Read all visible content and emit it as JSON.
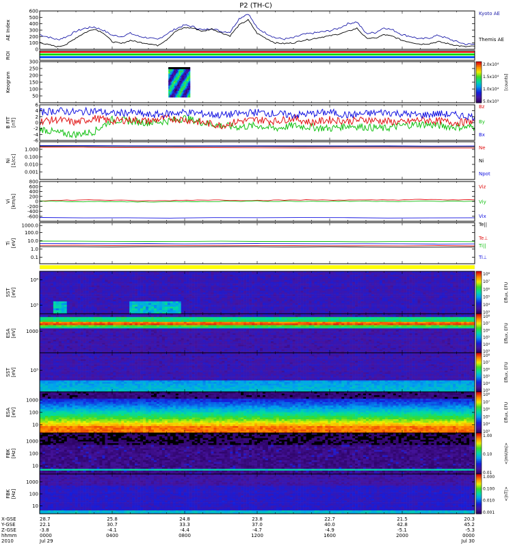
{
  "title": "P2 (TH-C)",
  "colors": {
    "kyoto": "#1a1aa8",
    "themis": "#000000",
    "red": "#e01010",
    "green": "#10c010",
    "blue": "#1010e0",
    "black": "#000000",
    "yellow": "#ffff00"
  },
  "chart_data": [
    {
      "type": "line",
      "panel": "ae",
      "ylabel": "AE Index",
      "ylim": [
        0,
        600
      ],
      "yticks": [
        "0",
        "100",
        "200",
        "300",
        "400",
        "500",
        "600"
      ],
      "legend": [
        "Kyoto AE",
        "Themis AE"
      ],
      "series": [
        {
          "name": "Kyoto AE",
          "x": [
            0,
            0.5,
            1,
            1.5,
            2,
            2.5,
            3,
            3.5,
            4,
            4.5,
            5,
            5.5,
            6,
            6.5,
            7,
            7.5,
            8,
            8.5,
            9,
            9.5,
            10,
            10.5,
            11,
            11.5,
            12,
            12.5,
            13,
            13.5,
            14,
            14.5,
            15,
            15.5,
            16,
            16.5,
            17,
            17.5,
            18,
            18.5,
            19,
            19.5,
            20,
            20.5,
            21,
            21.5,
            22,
            22.5,
            23,
            23.5,
            24
          ],
          "values": [
            230,
            190,
            150,
            200,
            280,
            330,
            350,
            300,
            220,
            200,
            250,
            200,
            180,
            150,
            240,
            320,
            380,
            350,
            300,
            330,
            280,
            270,
            480,
            560,
            330,
            250,
            180,
            160,
            180,
            230,
            250,
            270,
            290,
            330,
            400,
            430,
            250,
            260,
            340,
            300,
            230,
            200,
            160,
            180,
            220,
            170,
            120,
            80,
            80
          ]
        },
        {
          "name": "Themis AE",
          "x": [
            0,
            0.5,
            1,
            1.5,
            2,
            2.5,
            3,
            3.5,
            4,
            4.5,
            5,
            5.5,
            6,
            6.5,
            7,
            7.5,
            8,
            8.5,
            9,
            9.5,
            10,
            10.5,
            11,
            11.5,
            12,
            12.5,
            13,
            13.5,
            14,
            14.5,
            15,
            15.5,
            16,
            16.5,
            17,
            17.5,
            18,
            18.5,
            19,
            19.5,
            20,
            20.5,
            21,
            21.5,
            22,
            22.5,
            23,
            23.5,
            24
          ],
          "values": [
            110,
            70,
            40,
            80,
            180,
            260,
            320,
            260,
            120,
            90,
            140,
            110,
            90,
            60,
            150,
            280,
            340,
            330,
            280,
            320,
            260,
            210,
            380,
            460,
            250,
            170,
            100,
            90,
            100,
            140,
            160,
            190,
            210,
            240,
            280,
            330,
            180,
            170,
            230,
            200,
            140,
            110,
            80,
            90,
            120,
            90,
            60,
            40,
            50
          ]
        }
      ]
    },
    {
      "type": "heatmap",
      "panel": "roi",
      "ylabel": "ROI"
    },
    {
      "type": "heatmap",
      "panel": "keogram",
      "ylabel": "Keogram",
      "ylim": [
        0,
        300
      ],
      "yticks": [
        "50",
        "100",
        "150",
        "200",
        "250",
        "300"
      ],
      "colorbar": {
        "label": "[counts]",
        "ticks": [
          "2.0x10⁴",
          "1.5x10⁴",
          "1.0x10⁴",
          "5.0x10³"
        ]
      },
      "data_interval_hours": [
        7.1,
        8.3
      ]
    },
    {
      "type": "line",
      "panel": "bfield",
      "ylabel": "B FIT",
      "yunit": "[nT]",
      "ylim": [
        -6,
        6
      ],
      "yticks": [
        "-6",
        "-4",
        "-2",
        "0",
        "2",
        "4",
        "6"
      ],
      "legend": [
        "Bz",
        "By",
        "Bx"
      ],
      "series": [
        {
          "name": "Bz",
          "x": [
            0,
            1,
            2,
            3,
            4,
            5,
            6,
            7,
            8,
            9,
            10,
            11,
            12,
            13,
            14,
            15,
            16,
            17,
            18,
            19,
            20,
            21,
            22,
            23,
            24
          ],
          "values": [
            0.5,
            1.0,
            0.0,
            1.5,
            0.5,
            1.0,
            0.5,
            1.5,
            1.0,
            0.0,
            -1.0,
            0.5,
            1.0,
            0.5,
            1.5,
            0.0,
            1.0,
            0.5,
            1.0,
            0.5,
            0.0,
            1.0,
            0.5,
            0.0,
            0.5
          ]
        },
        {
          "name": "By",
          "x": [
            0,
            1,
            2,
            3,
            4,
            5,
            6,
            7,
            8,
            9,
            10,
            11,
            12,
            13,
            14,
            15,
            16,
            17,
            18,
            19,
            20,
            21,
            22,
            23,
            24
          ],
          "values": [
            -2.0,
            -3.5,
            -4.0,
            -3.0,
            1.0,
            0.5,
            0.0,
            0.5,
            1.5,
            0.0,
            -1.0,
            -1.5,
            -1.0,
            -2.0,
            -1.0,
            -1.5,
            -2.0,
            -1.0,
            -1.5,
            -2.0,
            -1.0,
            -0.5,
            -1.0,
            -1.5,
            -1.5
          ]
        },
        {
          "name": "Bx",
          "x": [
            0,
            1,
            2,
            3,
            4,
            5,
            6,
            7,
            8,
            9,
            10,
            11,
            12,
            13,
            14,
            15,
            16,
            17,
            18,
            19,
            20,
            21,
            22,
            23,
            24
          ],
          "values": [
            3.5,
            4.0,
            3.5,
            4.0,
            3.0,
            3.5,
            2.5,
            3.0,
            3.5,
            3.0,
            2.5,
            3.0,
            3.5,
            3.0,
            2.5,
            3.0,
            3.5,
            2.5,
            3.0,
            3.5,
            3.0,
            2.5,
            3.0,
            2.5,
            2.0
          ]
        }
      ]
    },
    {
      "type": "line",
      "panel": "density",
      "ylabel": "Ni",
      "yunit": "[1/cc]",
      "scale": "log",
      "ylim": [
        0.0001,
        10
      ],
      "yticks": [
        "0.001",
        "0.010",
        "0.100",
        "1.000"
      ],
      "legend": [
        "Ne",
        "Ni",
        "Npot"
      ],
      "series": [
        {
          "name": "Ne",
          "x": [
            0,
            24
          ],
          "values": [
            1.8,
            1.5
          ]
        },
        {
          "name": "Ni",
          "x": [
            0,
            24
          ],
          "values": [
            2.5,
            2.2
          ]
        },
        {
          "name": "Npot",
          "x": [
            0,
            24
          ],
          "values": [
            3.0,
            2.8
          ]
        }
      ]
    },
    {
      "type": "line",
      "panel": "velocity",
      "ylabel": "Vi",
      "yunit": "[km/s]",
      "ylim": [
        -800,
        800
      ],
      "yticks": [
        "-600",
        "-400",
        "-200",
        "0",
        "200",
        "400",
        "600",
        "800"
      ],
      "legend": [
        "Viz",
        "Viy",
        "Vix"
      ],
      "series": [
        {
          "name": "Viz",
          "x": [
            0,
            3,
            6,
            9,
            12,
            15,
            18,
            21,
            24
          ],
          "values": [
            30,
            60,
            20,
            60,
            40,
            60,
            50,
            70,
            60
          ]
        },
        {
          "name": "Viy",
          "x": [
            0,
            3,
            6,
            9,
            12,
            15,
            18,
            21,
            24
          ],
          "values": [
            10,
            -10,
            -20,
            0,
            10,
            0,
            10,
            0,
            10
          ]
        },
        {
          "name": "Vix",
          "x": [
            0,
            24
          ],
          "values": [
            -660,
            -660
          ]
        }
      ]
    },
    {
      "type": "line",
      "panel": "temperature",
      "ylabel": "Ti",
      "yunit": "[eV]",
      "scale": "log",
      "ylim": [
        0.05,
        10000
      ],
      "yticks": [
        "0.1",
        "1.0",
        "10.0",
        "100.0",
        "1000.0"
      ],
      "legend": [
        "Te||",
        "Te⊥",
        "Ti||",
        "Ti⊥"
      ],
      "series": [
        {
          "name": "Te||",
          "x": [
            0,
            24
          ],
          "values": [
            40,
            35
          ]
        },
        {
          "name": "Te⊥",
          "x": [
            0,
            24
          ],
          "values": [
            12,
            10
          ]
        },
        {
          "name": "Ti||",
          "x": [
            0,
            24
          ],
          "values": [
            20,
            18
          ]
        },
        {
          "name": "Ti⊥",
          "x": [
            0,
            24
          ],
          "values": [
            8,
            7
          ]
        }
      ]
    },
    {
      "type": "heatmap",
      "panel": "sst_ion",
      "ylabel": "SST",
      "yunit": "[eV]",
      "yticks": [
        "10⁵",
        "10⁶"
      ],
      "colorbar": {
        "label": "Eflux, EFU",
        "ticks": [
          "10⁸",
          "10⁷",
          "10⁶",
          "10⁵",
          "10⁴",
          "10³"
        ]
      }
    },
    {
      "type": "heatmap",
      "panel": "esa_ion",
      "ylabel": "ESA",
      "yunit": "[eV]",
      "yticks": [
        "1000"
      ],
      "colorbar": {
        "label": "Eflux, EFU",
        "ticks": [
          "10⁸",
          "10⁷",
          "10⁶",
          "10⁵",
          "10⁴",
          "10³"
        ]
      }
    },
    {
      "type": "heatmap",
      "panel": "sst_elec",
      "ylabel": "SST",
      "yunit": "[eV]",
      "yticks": [
        "10⁵"
      ],
      "colorbar": {
        "label": "Eflux, EFU",
        "ticks": [
          "10⁸",
          "10⁷",
          "10⁶",
          "10⁵",
          "10⁴",
          "10³"
        ]
      }
    },
    {
      "type": "heatmap",
      "panel": "esa_elec",
      "ylabel": "ESA",
      "yunit": "[eV]",
      "yticks": [
        "10",
        "100",
        "1000"
      ],
      "colorbar": {
        "label": "Eflux, EFU",
        "ticks": [
          "10⁸",
          "10⁷",
          "10⁶",
          "10⁵",
          "10⁴",
          "10³"
        ]
      }
    },
    {
      "type": "heatmap",
      "panel": "fbk_edc",
      "ylabel": "FBK",
      "yunit": "[Hz]",
      "yticks": [
        "10",
        "100",
        "1000"
      ],
      "colorbar": {
        "label": "<|mV/m|>",
        "ticks": [
          "1.00",
          "0.10",
          "0.01"
        ]
      }
    },
    {
      "type": "heatmap",
      "panel": "fbk_scm",
      "ylabel": "FBK",
      "yunit": "[Hz]",
      "yticks": [
        "10",
        "100",
        "1000"
      ],
      "colorbar": {
        "label": "<|nT|>",
        "ticks": [
          "1.000",
          "0.100",
          "0.010",
          "0.001"
        ]
      }
    }
  ],
  "time_axis": {
    "row_labels": [
      "X-GSE",
      "Y-GSE",
      "Z-GSE",
      "hhmm",
      "2010"
    ],
    "columns": [
      {
        "x_hours": 0,
        "rows": [
          "28.7",
          "22.1",
          "-3.8",
          "0000",
          "Jul 29"
        ]
      },
      {
        "x_hours": 4,
        "rows": [
          "25.8",
          "30.7",
          "-4.1",
          "0400",
          ""
        ]
      },
      {
        "x_hours": 8,
        "rows": [
          "24.8",
          "33.3",
          "-4.4",
          "0800",
          ""
        ]
      },
      {
        "x_hours": 12,
        "rows": [
          "23.8",
          "37.0",
          "-4.7",
          "1200",
          ""
        ]
      },
      {
        "x_hours": 16,
        "rows": [
          "22.7",
          "40.0",
          "-4.9",
          "1600",
          ""
        ]
      },
      {
        "x_hours": 20,
        "rows": [
          "21.5",
          "42.8",
          "-5.1",
          "2000",
          ""
        ]
      },
      {
        "x_hours": 24,
        "rows": [
          "20.3",
          "45.2",
          "-5.3",
          "0000",
          "Jul 30"
        ]
      }
    ]
  }
}
